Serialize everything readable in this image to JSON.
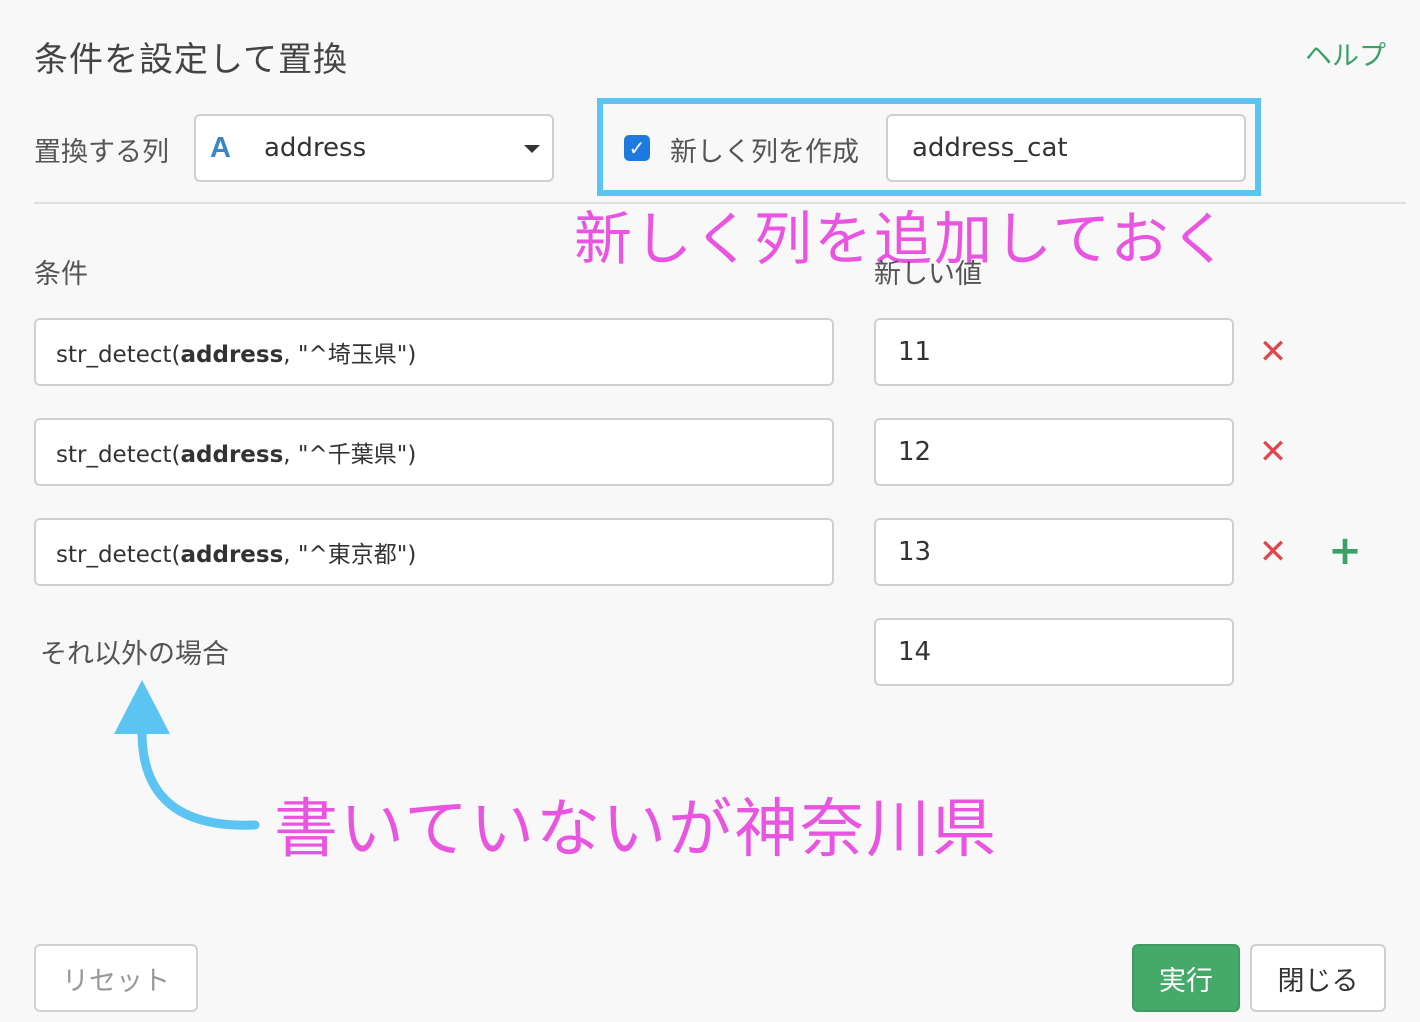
{
  "dialog": {
    "title": "条件を設定して置換",
    "help_label": "ヘルプ"
  },
  "target_column": {
    "label": "置換する列",
    "type_icon": "A",
    "selected": "address"
  },
  "new_column": {
    "checked": true,
    "label": "新しく列を作成",
    "value": "address_cat"
  },
  "headers": {
    "condition": "条件",
    "new_value": "新しい値"
  },
  "rules": [
    {
      "prefix": "str_detect(",
      "column": "address",
      "suffix": ", \"^埼玉県\")",
      "value": "11"
    },
    {
      "prefix": "str_detect(",
      "column": "address",
      "suffix": ", \"^千葉県\")",
      "value": "12"
    },
    {
      "prefix": "str_detect(",
      "column": "address",
      "suffix": ", \"^東京都\")",
      "value": "13"
    }
  ],
  "otherwise": {
    "label": "それ以外の場合",
    "value": "14"
  },
  "buttons": {
    "reset": "リセット",
    "run": "実行",
    "close": "閉じる"
  },
  "annotations": {
    "new_column_note": "新しく列を追加しておく",
    "otherwise_note": "書いていないが神奈川県"
  },
  "colors": {
    "highlight_border": "#5bc4f2",
    "annotation_text": "#e955e0",
    "arrow": "#5bc4f2",
    "primary_button": "#45a96a",
    "delete_icon": "#e0474c",
    "add_icon": "#3aa168"
  },
  "icons": {
    "delete": "close-icon",
    "add": "plus-icon",
    "dropdown": "caret-down-icon",
    "checkbox": "checkmark-icon"
  }
}
